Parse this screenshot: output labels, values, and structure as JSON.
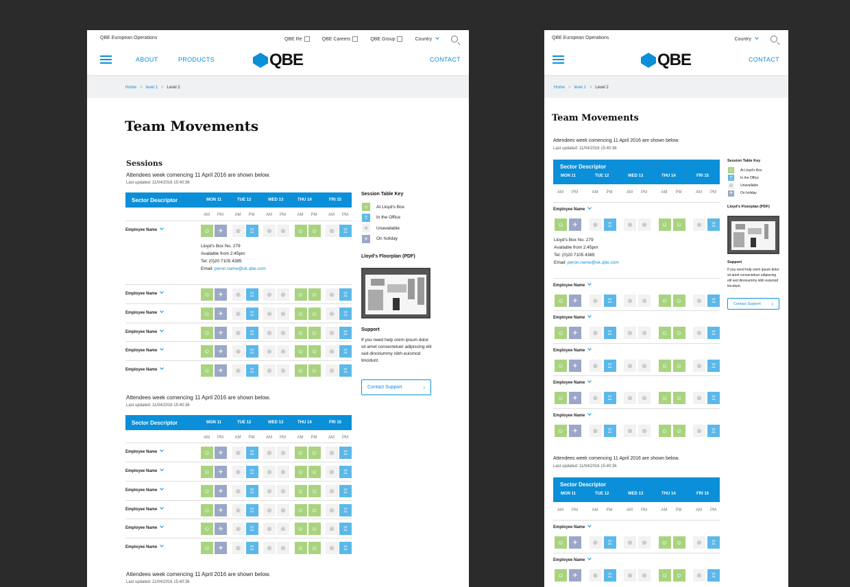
{
  "header": {
    "brand_operations": "QBE European Operations",
    "top_links": [
      "QBE Re",
      "QBE Careers",
      "QBE Group"
    ],
    "country": "Country",
    "nav": {
      "about": "ABOUT",
      "products": "PRODUCTS",
      "contact": "CONTACT"
    },
    "logo_text": "QBE"
  },
  "breadcrumb": {
    "home": "Home",
    "level1": "level 1",
    "current": "Level 2",
    "sep": ">"
  },
  "page_title": "Team Movements",
  "sessions_heading": "Sessions",
  "attendees_text": "Attendees week comencing 11 April 2016 are shown below.",
  "last_updated": "Last updated: 11/04/2016 15:40:36",
  "table": {
    "sector": "Sector Descriptor",
    "days": [
      "MON 11",
      "TUE 12",
      "WED 13",
      "THU 14",
      "FRI 15"
    ],
    "am": "AM",
    "pm": "PM",
    "employee_name": "Employee Name",
    "row_pattern": [
      "lloyds",
      "holiday",
      "unavailable",
      "office",
      "unavailable",
      "unavailable",
      "lloyds",
      "lloyds",
      "unavailable",
      "office"
    ]
  },
  "detail": {
    "line1": "Lloyd's Box No. 279",
    "line2": "Available from 2:45pm",
    "line3": "Tel: (0)20 7105 4385",
    "email_label": "Email: ",
    "email": "peron.name@uk.qbe.com"
  },
  "key": {
    "title": "Session Table Key",
    "items": [
      "At Lloyd's Box",
      "In the Office",
      "Unavailable",
      "On holiday"
    ]
  },
  "floorplan": {
    "title": "Lloyd's Floorplan (PDF)"
  },
  "support": {
    "title": "Support",
    "text": "If you need help orem ipsum dolor sit amet consectetuer adipiscing elit sed dinonummy nibh euismod tincidunt.",
    "button": "Contact Support"
  },
  "colors": {
    "accent": "#0a8fd8",
    "lloyds": "#a9d37f",
    "office": "#5bb8e8",
    "unavailable": "#f2f2f2",
    "holiday": "#9aa7c7"
  }
}
